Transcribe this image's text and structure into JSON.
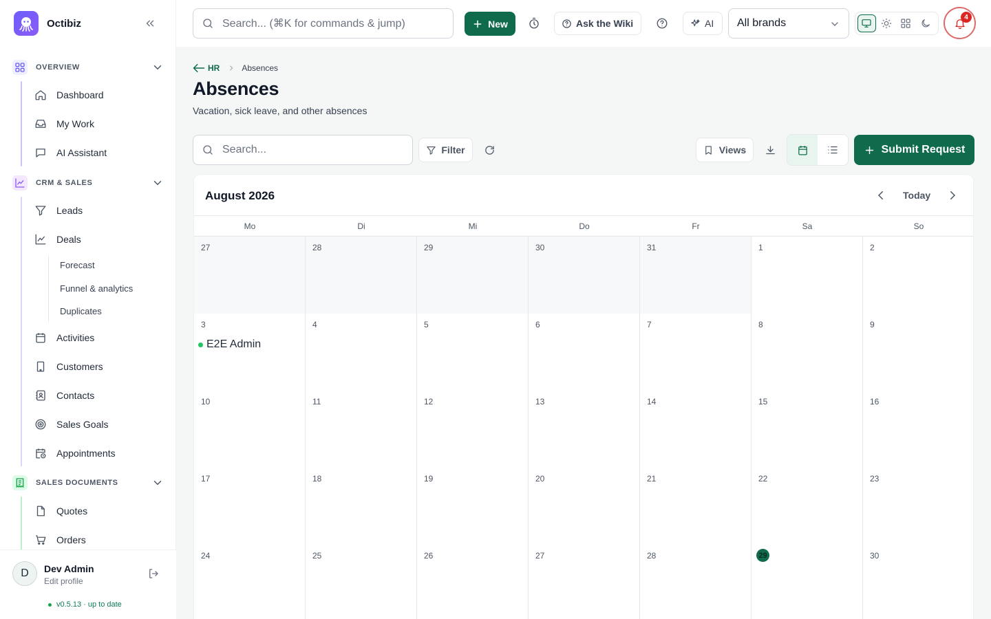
{
  "app": {
    "name": "Octibiz"
  },
  "sidebar": {
    "sections": [
      {
        "label": "OVERVIEW",
        "items": [
          {
            "label": "Dashboard"
          },
          {
            "label": "My Work"
          },
          {
            "label": "AI Assistant"
          }
        ]
      },
      {
        "label": "CRM & SALES",
        "items": [
          {
            "label": "Leads"
          },
          {
            "label": "Deals"
          },
          {
            "label": "Activities"
          },
          {
            "label": "Customers"
          },
          {
            "label": "Contacts"
          },
          {
            "label": "Sales Goals"
          },
          {
            "label": "Appointments"
          }
        ],
        "deal_subitems": [
          {
            "label": "Forecast"
          },
          {
            "label": "Funnel & analytics"
          },
          {
            "label": "Duplicates"
          }
        ]
      },
      {
        "label": "SALES DOCUMENTS",
        "items": [
          {
            "label": "Quotes"
          },
          {
            "label": "Orders"
          }
        ]
      }
    ],
    "user": {
      "initial": "D",
      "name": "Dev Admin",
      "sub": "Edit profile"
    },
    "version": "v0.5.13 · up to date"
  },
  "topbar": {
    "search_placeholder": "Search... (⌘K for commands & jump)",
    "new_label": "New",
    "wiki_label": "Ask the Wiki",
    "ai_label": "AI",
    "brand_select": "All brands",
    "notification_count": "4"
  },
  "page": {
    "breadcrumb_parent": "HR",
    "breadcrumb_current": "Absences",
    "title": "Absences",
    "subtitle": "Vacation, sick leave, and other absences",
    "search_placeholder": "Search...",
    "filter_label": "Filter",
    "views_label": "Views",
    "submit_label": "Submit Request"
  },
  "calendar": {
    "month": "August 2026",
    "today_label": "Today",
    "weekdays": [
      "Mo",
      "Di",
      "Mi",
      "Do",
      "Fr",
      "Sa",
      "So"
    ],
    "weeks": [
      [
        {
          "d": "27",
          "out": true
        },
        {
          "d": "28",
          "out": true
        },
        {
          "d": "29",
          "out": true
        },
        {
          "d": "30",
          "out": true
        },
        {
          "d": "31",
          "out": true
        },
        {
          "d": "1"
        },
        {
          "d": "2"
        }
      ],
      [
        {
          "d": "3",
          "event": "E2E Admin"
        },
        {
          "d": "4"
        },
        {
          "d": "5"
        },
        {
          "d": "6"
        },
        {
          "d": "7"
        },
        {
          "d": "8"
        },
        {
          "d": "9"
        }
      ],
      [
        {
          "d": "10"
        },
        {
          "d": "11"
        },
        {
          "d": "12"
        },
        {
          "d": "13"
        },
        {
          "d": "14"
        },
        {
          "d": "15"
        },
        {
          "d": "16"
        }
      ],
      [
        {
          "d": "17"
        },
        {
          "d": "18"
        },
        {
          "d": "19"
        },
        {
          "d": "20"
        },
        {
          "d": "21"
        },
        {
          "d": "22"
        },
        {
          "d": "23"
        }
      ],
      [
        {
          "d": "24"
        },
        {
          "d": "25"
        },
        {
          "d": "26"
        },
        {
          "d": "27"
        },
        {
          "d": "28"
        },
        {
          "d": "29",
          "today": true
        },
        {
          "d": "30"
        }
      ]
    ]
  },
  "colors": {
    "primary": "#0f6b4c",
    "event_dot": "#22c55e",
    "notification": "#dc2626"
  }
}
